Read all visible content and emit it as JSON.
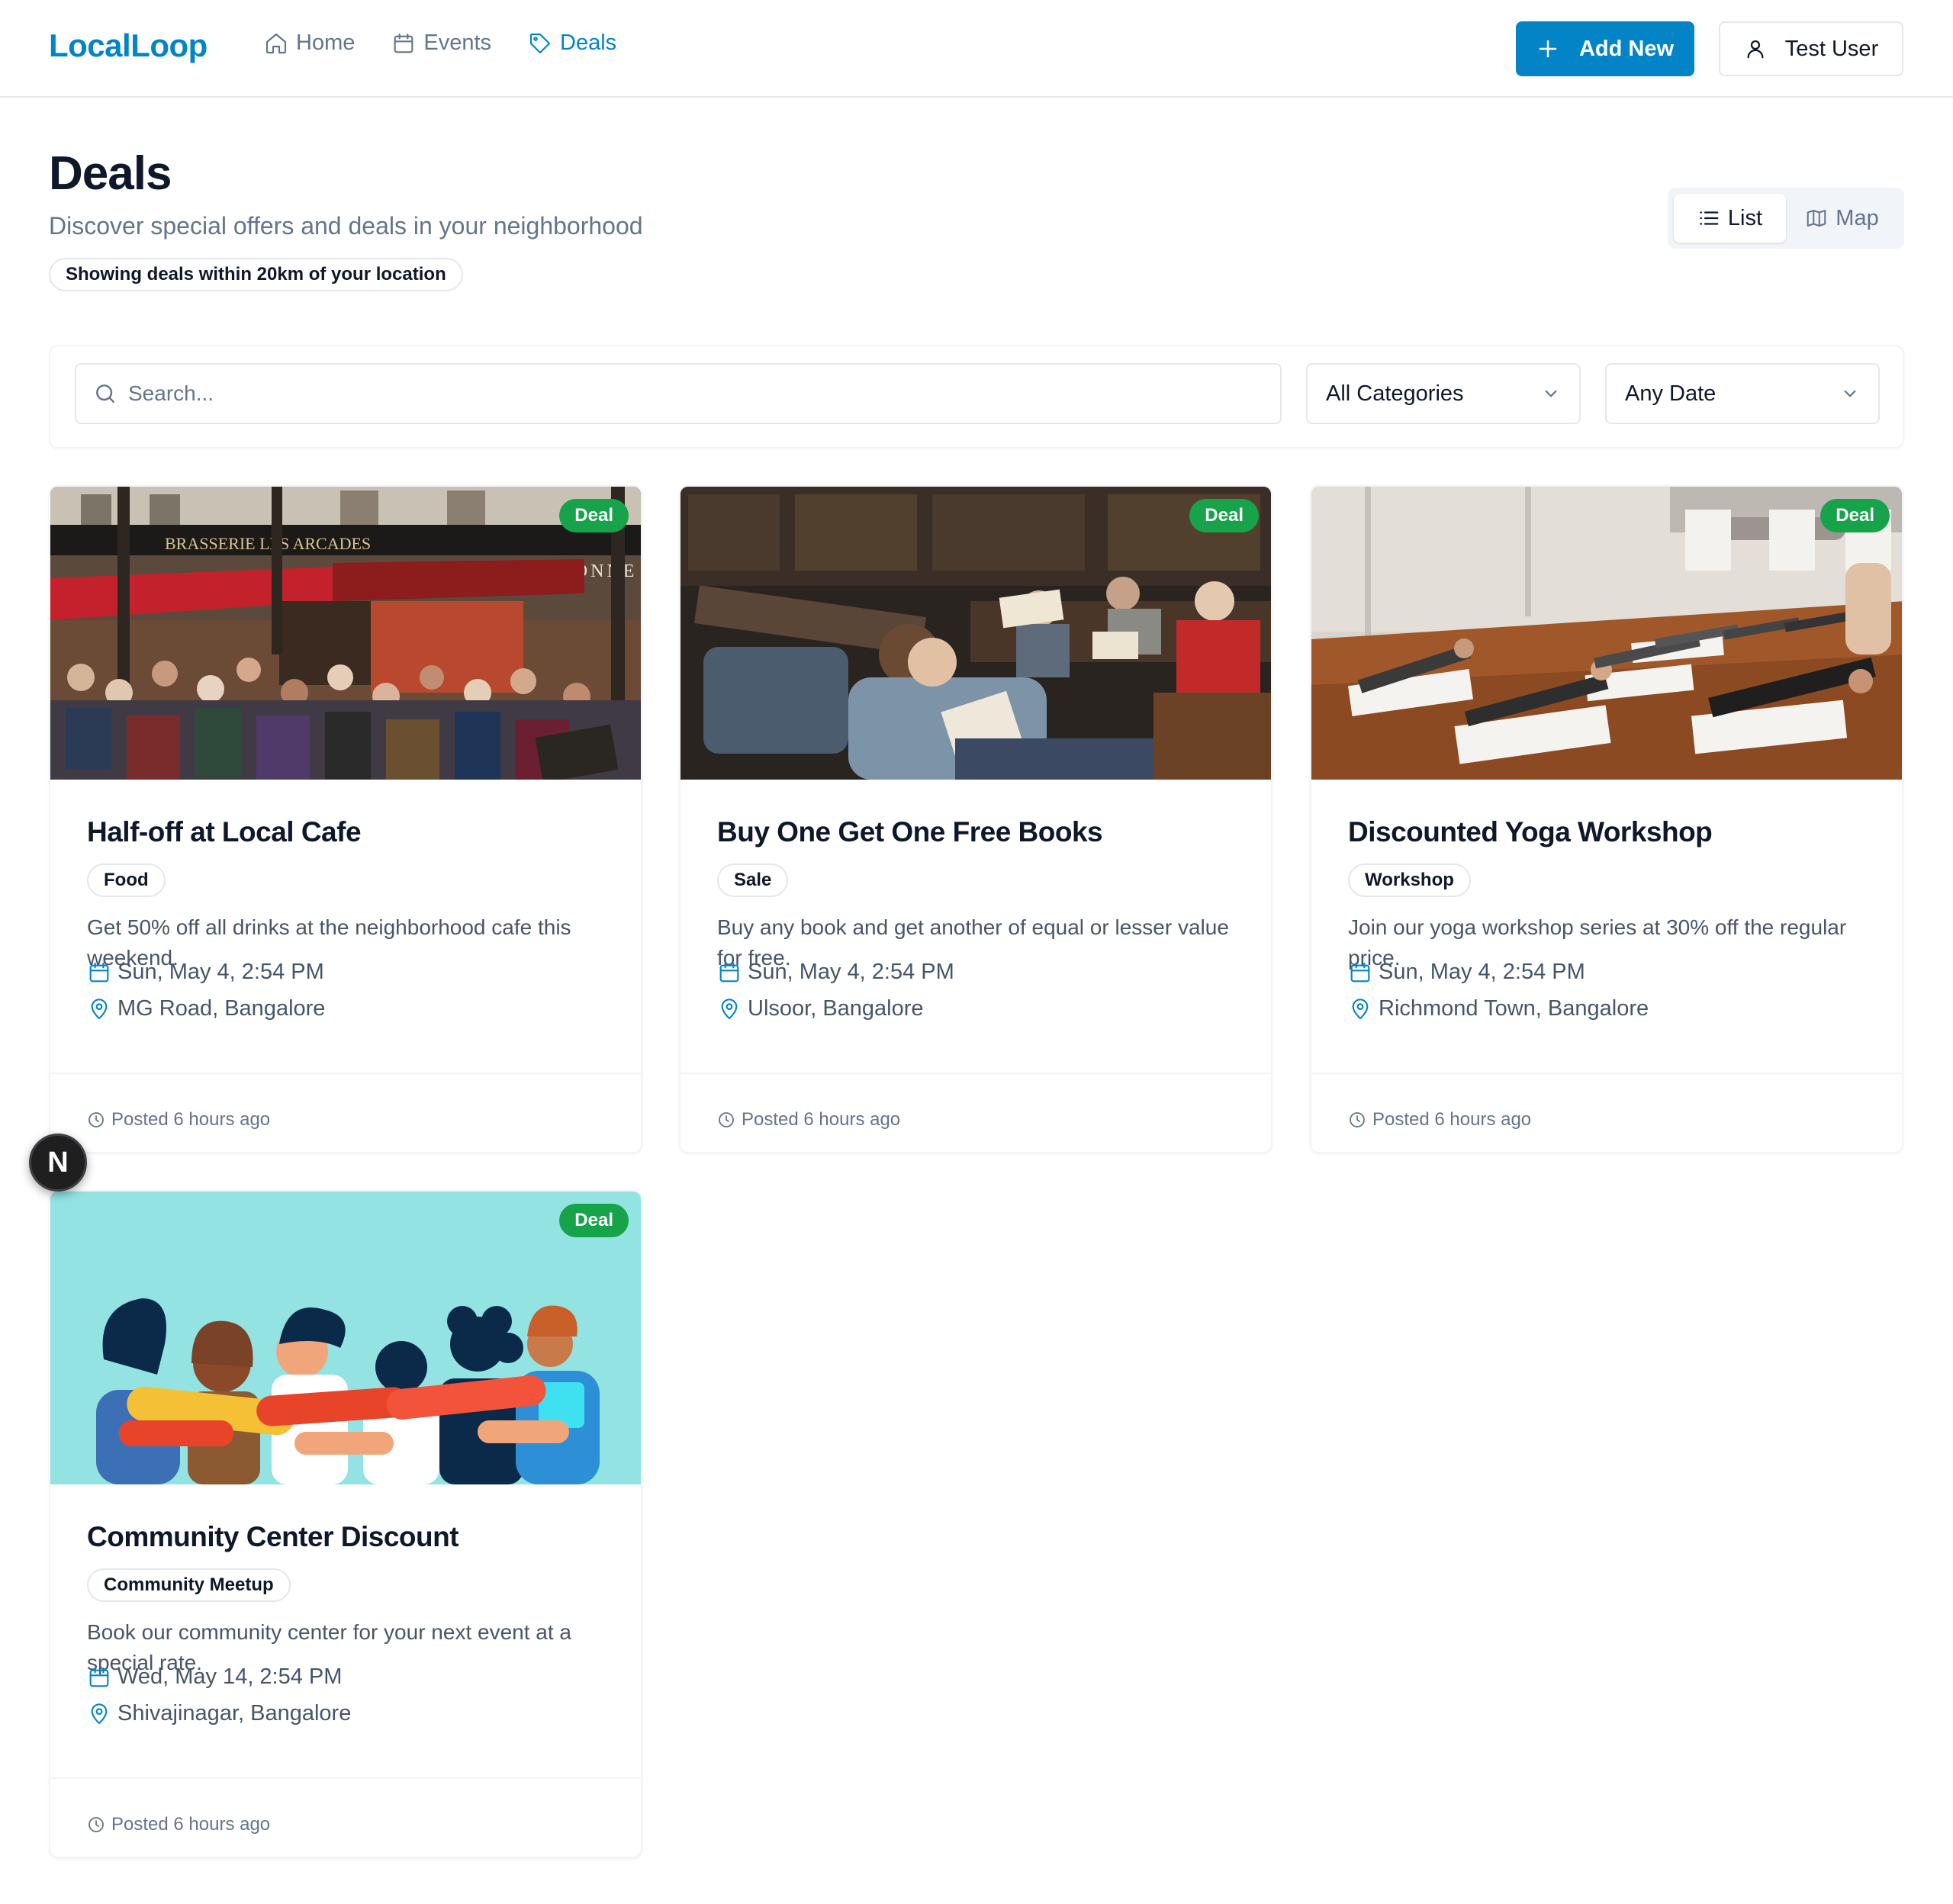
{
  "app": {
    "logo": "LocalLoop"
  },
  "nav": {
    "items": [
      {
        "label": "Home",
        "icon": "home-icon"
      },
      {
        "label": "Events",
        "icon": "calendar-icon"
      },
      {
        "label": "Deals",
        "icon": "tag-icon",
        "active": true
      }
    ]
  },
  "header": {
    "add_label": "Add New",
    "user_label": "Test User"
  },
  "page": {
    "title": "Deals",
    "subtitle": "Discover special offers and deals in your neighborhood",
    "range_note": "Showing deals within 20km of your location"
  },
  "view_toggle": {
    "list_label": "List",
    "map_label": "Map",
    "selected": "List"
  },
  "filters": {
    "search_placeholder": "Search...",
    "search_value": "",
    "category_value": "All Categories",
    "date_value": "Any Date"
  },
  "deals": [
    {
      "badge": "Deal",
      "title": "Half-off at Local Cafe",
      "tag": "Food",
      "description": "Get 50% off all drinks at the neighborhood cafe this weekend.",
      "date": "Sun, May 4, 2:54 PM",
      "location": "MG Road, Bangalore",
      "posted": "Posted 6 hours ago",
      "image": "cafe-photo"
    },
    {
      "badge": "Deal",
      "title": "Buy One Get One Free Books",
      "tag": "Sale",
      "description": "Buy any book and get another of equal or lesser value for free.",
      "date": "Sun, May 4, 2:54 PM",
      "location": "Ulsoor, Bangalore",
      "posted": "Posted 6 hours ago",
      "image": "library-photo"
    },
    {
      "badge": "Deal",
      "title": "Discounted Yoga Workshop",
      "tag": "Workshop",
      "description": "Join our yoga workshop series at 30% off the regular price.",
      "date": "Sun, May 4, 2:54 PM",
      "location": "Richmond Town, Bangalore",
      "posted": "Posted 6 hours ago",
      "image": "yoga-photo"
    },
    {
      "badge": "Deal",
      "title": "Community Center Discount",
      "tag": "Community Meetup",
      "description": "Book our community center for your next event at a special rate.",
      "date": "Wed, May 14, 2:54 PM",
      "location": "Shivajinagar, Bangalore",
      "posted": "Posted 6 hours ago",
      "image": "community-illustration"
    }
  ],
  "dev_badge": {
    "label": "N"
  },
  "colors": {
    "accent": "#0284c7",
    "deal_badge": "#16a34a",
    "text": "#0f172a",
    "muted": "#64748b"
  }
}
